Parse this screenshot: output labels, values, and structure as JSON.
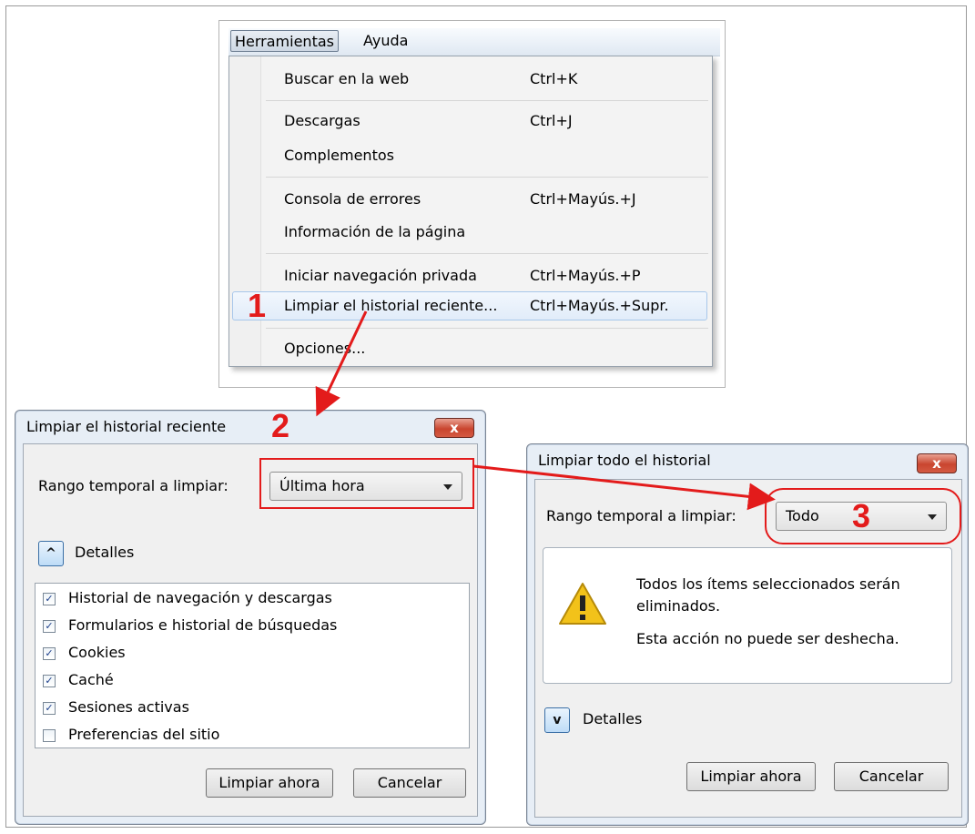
{
  "menu": {
    "bar": [
      "Herramientas",
      "Ayuda"
    ],
    "items": [
      {
        "label": "Buscar en la web",
        "shortcut": "Ctrl+K"
      },
      {
        "label": "Descargas",
        "shortcut": "Ctrl+J"
      },
      {
        "label": "Complementos",
        "shortcut": ""
      },
      {
        "label": "Consola de errores",
        "shortcut": "Ctrl+Mayús.+J"
      },
      {
        "label": "Información de la página",
        "shortcut": ""
      },
      {
        "label": "Iniciar navegación privada",
        "shortcut": "Ctrl+Mayús.+P"
      },
      {
        "label": "Limpiar el historial reciente...",
        "shortcut": "Ctrl+Mayús.+Supr."
      },
      {
        "label": "Opciones...",
        "shortcut": ""
      }
    ]
  },
  "steps": [
    "1",
    "2",
    "3"
  ],
  "dialog1": {
    "title": "Limpiar el historial reciente",
    "close_label": "x",
    "range_label": "Rango temporal a limpiar:",
    "range_value": "Última hora",
    "details_label": "Detalles",
    "items": [
      {
        "label": "Historial de navegación y descargas",
        "checked": true
      },
      {
        "label": "Formularios e historial de búsquedas",
        "checked": true
      },
      {
        "label": "Cookies",
        "checked": true
      },
      {
        "label": "Caché",
        "checked": true
      },
      {
        "label": "Sesiones activas",
        "checked": true
      },
      {
        "label": "Preferencias del sitio",
        "checked": false
      }
    ],
    "clear_button": "Limpiar ahora",
    "cancel_button": "Cancelar"
  },
  "dialog2": {
    "title": "Limpiar todo el historial",
    "close_label": "x",
    "range_label": "Rango temporal a limpiar:",
    "range_value": "Todo",
    "warning_line1": "Todos los ítems seleccionados serán",
    "warning_line2": "eliminados.",
    "warning_line3": "Esta acción no puede ser deshecha.",
    "details_label": "Detalles",
    "clear_button": "Limpiar ahora",
    "cancel_button": "Cancelar"
  },
  "colors": {
    "annotation": "#e31b1b",
    "dialog_frame": "#e7eef6"
  }
}
